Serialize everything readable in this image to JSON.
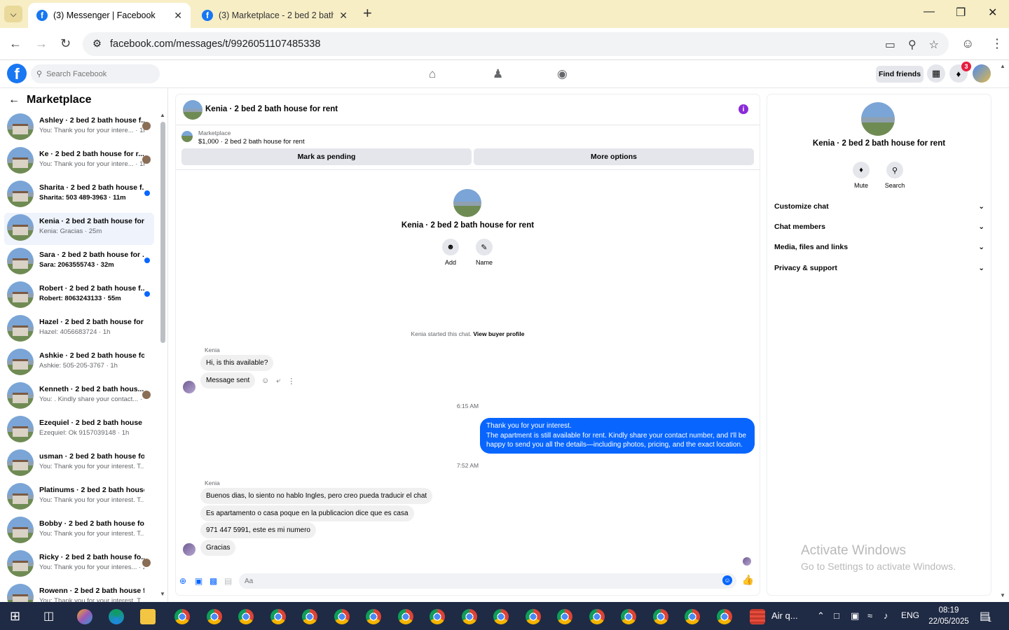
{
  "browser": {
    "tabs": [
      {
        "title": "(3) Messenger | Facebook",
        "active": true
      },
      {
        "title": "(3) Marketplace - 2 bed 2 bath h",
        "active": false
      }
    ],
    "url": "facebook.com/messages/t/9926051107485338"
  },
  "fb_header": {
    "search_placeholder": "Search Facebook",
    "find_friends": "Find friends",
    "notification_count": "3"
  },
  "left_panel": {
    "title": "Marketplace",
    "conversations": [
      {
        "name": "Ashley · 2 bed 2 bath house f...",
        "snippet": "You: Thank you for your intere... · 1m",
        "unread": false,
        "status": "seen"
      },
      {
        "name": "Ke · 2 bed 2 bath house for r...",
        "snippet": "You: Thank you for your intere... · 1m",
        "unread": false,
        "status": "seen"
      },
      {
        "name": "Sharita · 2 bed 2 bath house f...",
        "snippet": "Sharita: 503 489-3963 · 11m",
        "unread": true,
        "status": "dot"
      },
      {
        "name": "Kenia · 2 bed 2 bath house for ...",
        "snippet": "Kenia: Gracias · 25m",
        "unread": false,
        "status": "none",
        "active": true
      },
      {
        "name": "Sara · 2 bed 2 bath house for ...",
        "snippet": "Sara: 2063555743 · 32m",
        "unread": true,
        "status": "dot"
      },
      {
        "name": "Robert · 2 bed 2 bath house f...",
        "snippet": "Robert: 8063243133 · 55m",
        "unread": true,
        "status": "dot"
      },
      {
        "name": "Hazel · 2 bed 2 bath house for ...",
        "snippet": "Hazel: 4056683724 · 1h",
        "unread": false,
        "status": "none"
      },
      {
        "name": "Ashkie · 2 bed 2 bath house for...",
        "snippet": "Ashkie: 505-205-3767 · 1h",
        "unread": false,
        "status": "none"
      },
      {
        "name": "Kenneth · 2 bed 2 bath hous...",
        "snippet": "You: . Kindly share your contact... · 1h",
        "unread": false,
        "status": "seen"
      },
      {
        "name": "Ezequiel · 2 bed 2 bath house f...",
        "snippet": "Ezequiel: Ok 9157039148 · 1h",
        "unread": false,
        "status": "none"
      },
      {
        "name": "usman · 2 bed 2 bath house for...",
        "snippet": "You: Thank you for your interest. T... · 2h",
        "unread": false,
        "status": "none"
      },
      {
        "name": "Platinums · 2 bed 2 bath house...",
        "snippet": "You: Thank you for your interest. T... · 2h",
        "unread": false,
        "status": "none"
      },
      {
        "name": "Bobby · 2 bed 2 bath house for...",
        "snippet": "You: Thank you for your interest. T... · 2h",
        "unread": false,
        "status": "none"
      },
      {
        "name": "Ricky · 2 bed 2 bath house fo...",
        "snippet": "You: Thank you for your interes... · 2h",
        "unread": false,
        "status": "seen"
      },
      {
        "name": "Rowenn · 2 bed 2 bath house f...",
        "snippet": "You: Thank you for your interest. T... · 2h",
        "unread": false,
        "status": "none"
      }
    ]
  },
  "chat": {
    "title": "Kenia · 2 bed 2 bath house for rent",
    "marketplace_label": "Marketplace",
    "listing": "$1,000 · 2 bed 2 bath house for rent",
    "mark_pending": "Mark as pending",
    "more_options": "More options",
    "center_name": "Kenia · 2 bed 2 bath house for rent",
    "add_label": "Add",
    "name_label": "Name",
    "system_text": "Kenia started this chat.",
    "system_link": "View buyer profile",
    "sender": "Kenia",
    "msg1": "Hi, is this available?",
    "msg2": "Message sent",
    "time1": "6:15 AM",
    "out_line1": "Thank you for your interest.",
    "out_line2": "The apartment is still available for rent. Kindly share your contact number, and I'll be happy to send you all the details—including photos, pricing, and the exact location.",
    "time2": "7:52 AM",
    "sender2": "Kenia",
    "msg3": "Buenos dias, lo siento no hablo Ingles, pero creo pueda traducir el chat",
    "msg4": "Es apartamento o casa poque en la publicacion dice que es casa",
    "msg5": "971 447 5991, este es mi numero",
    "msg6": "Gracias",
    "composer_placeholder": "Aa"
  },
  "right_panel": {
    "name": "Kenia · 2 bed 2 bath house for rent",
    "mute": "Mute",
    "search": "Search",
    "sections": [
      "Customize chat",
      "Chat members",
      "Media, files and links",
      "Privacy & support"
    ]
  },
  "watermark": {
    "line1": "Activate Windows",
    "line2": "Go to Settings to activate Windows."
  },
  "taskbar": {
    "weather": "Air q...",
    "lang": "ENG",
    "time": "08:19",
    "date": "22/05/2025",
    "notif_count": "1"
  }
}
